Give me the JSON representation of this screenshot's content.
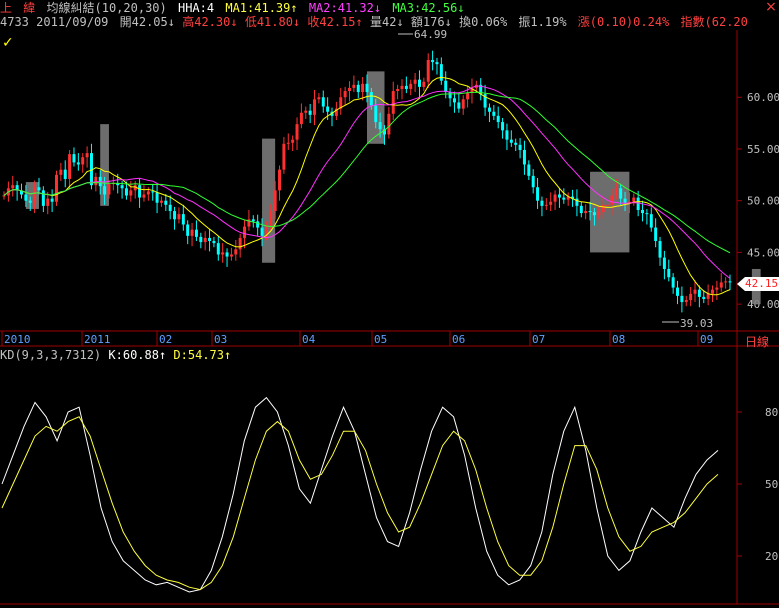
{
  "header": {
    "market": "上",
    "stock_name": "緯",
    "indicator": "均線糾結(10,20,30)",
    "hha": "HHA:4",
    "ma1": "MA1:41.39↑",
    "ma2": "MA2:41.32↓",
    "ma3": "MA3:42.56↓",
    "code": "4733",
    "date": "2011/09/09",
    "open": "開42.05↓",
    "high": "高42.30↓",
    "low": "低41.80↓",
    "close": "收42.15↑",
    "volume": "量42↓",
    "amount": "額176↓",
    "turnover": "換0.06%",
    "amplitude": "振1.19%",
    "change_label": "漲",
    "change_value": "(0.10)0.24%",
    "index": "指數(62.20"
  },
  "close_icon": "×",
  "check_icon": "✓",
  "price_tag": "42.15",
  "period_label": "日線",
  "kd_header": {
    "params": "KD(9,3,3,7312)",
    "k": "K:60.88↑",
    "d": "D:54.73↑"
  },
  "colors": {
    "up": "#ff3030",
    "down": "#00ffff",
    "ma1": "#ffff00",
    "ma2": "#ff30ff",
    "ma3": "#30ff30",
    "shade": "#808080",
    "axis": "#a00000",
    "k_line": "#ffffff",
    "d_line": "#ffff40"
  },
  "chart_data": [
    {
      "type": "candlestick",
      "title": "均線糾結(10,20,30)",
      "y_ticks": [
        "40.00",
        "45.00",
        "50.00",
        "55.00",
        "60.00"
      ],
      "ylim": [
        37.5,
        66.5
      ],
      "x_ticks": [
        "2010",
        "2011",
        "02",
        "03",
        "04",
        "05",
        "06",
        "07",
        "08",
        "09"
      ],
      "annotations": {
        "high_label": "64.99",
        "low_label": "39.03"
      },
      "close_series": [
        50.5,
        51.2,
        51.5,
        51.0,
        50.6,
        50.0,
        49.8,
        51.3,
        51.0,
        49.5,
        50.2,
        49.9,
        52.5,
        53.0,
        52.1,
        54.5,
        53.7,
        53.5,
        54.2,
        54.6,
        51.5,
        52.3,
        51.4,
        50.6,
        51.6,
        51.7,
        51.5,
        51.2,
        50.5,
        51.0,
        51.5,
        50.3,
        50.6,
        50.9,
        50.8,
        49.8,
        50.0,
        49.6,
        49.0,
        48.2,
        48.7,
        47.7,
        46.6,
        47.2,
        46.5,
        46.0,
        46.4,
        46.1,
        45.9,
        44.8,
        45.0,
        44.6,
        44.8,
        45.3,
        46.4,
        47.5,
        48.2,
        48.0,
        47.4,
        46.6,
        47.6,
        49.0,
        51.0,
        53.0,
        55.5,
        55.6,
        55.9,
        57.4,
        58.5,
        58.7,
        58.3,
        59.8,
        60.0,
        59.1,
        58.6,
        58.2,
        58.9,
        60.0,
        60.6,
        60.9,
        61.2,
        60.5,
        61.3,
        60.5,
        59.2,
        57.6,
        56.9,
        56.4,
        58.4,
        60.6,
        60.8,
        61.1,
        60.8,
        61.3,
        61.7,
        61.0,
        61.5,
        63.6,
        63.4,
        63.2,
        61.6,
        60.5,
        59.9,
        59.5,
        58.9,
        59.8,
        60.4,
        60.9,
        61.2,
        60.3,
        59.0,
        58.6,
        58.2,
        57.6,
        56.8,
        55.9,
        55.6,
        55.4,
        54.9,
        53.5,
        52.4,
        51.3,
        50.0,
        49.5,
        49.6,
        49.9,
        50.6,
        50.3,
        50.1,
        50.4,
        50.2,
        49.5,
        48.8,
        49.0,
        48.9,
        48.6,
        48.9,
        49.6,
        49.6,
        50.5,
        51.2,
        50.2,
        49.8,
        49.9,
        50.3,
        49.1,
        48.8,
        48.7,
        47.4,
        46.1,
        44.5,
        43.4,
        42.6,
        41.6,
        40.8,
        40.2,
        40.4,
        41.0,
        41.4,
        40.7,
        40.5,
        41.0,
        41.4,
        41.6,
        42.1,
        42.2,
        42.15
      ],
      "ma_series_names": [
        "MA1",
        "MA2",
        "MA3"
      ]
    },
    {
      "type": "line",
      "title": "KD(9,3,3,7312)",
      "y_ticks": [
        "20",
        "50",
        "80"
      ],
      "ylim": [
        0,
        100
      ],
      "series": [
        {
          "name": "K",
          "values": [
            50,
            62,
            74,
            84,
            78,
            68,
            80,
            82,
            62,
            40,
            26,
            18,
            14,
            10,
            8,
            9,
            7,
            5,
            6,
            14,
            28,
            46,
            68,
            82,
            86,
            80,
            66,
            48,
            42,
            56,
            70,
            82,
            72,
            54,
            36,
            26,
            24,
            38,
            56,
            72,
            82,
            78,
            62,
            40,
            22,
            12,
            8,
            10,
            16,
            30,
            54,
            72,
            82,
            64,
            40,
            20,
            14,
            18,
            30,
            40,
            36,
            32,
            44,
            54,
            60,
            64
          ]
        },
        {
          "name": "D",
          "values": [
            40,
            50,
            60,
            70,
            74,
            72,
            76,
            78,
            70,
            56,
            42,
            30,
            22,
            16,
            12,
            10,
            9,
            7,
            6,
            9,
            16,
            28,
            44,
            60,
            72,
            76,
            72,
            60,
            52,
            54,
            62,
            72,
            72,
            64,
            50,
            38,
            30,
            32,
            42,
            54,
            66,
            72,
            68,
            56,
            40,
            26,
            16,
            12,
            12,
            18,
            32,
            50,
            66,
            66,
            56,
            40,
            28,
            22,
            24,
            30,
            32,
            34,
            38,
            44,
            50,
            54
          ]
        }
      ]
    }
  ]
}
